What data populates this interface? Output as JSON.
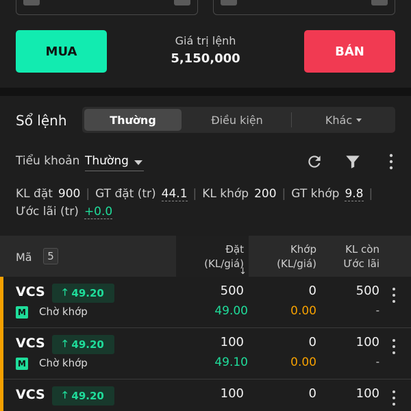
{
  "action": {
    "buy_label": "MUA",
    "sell_label": "BÁN",
    "order_value_label": "Giá trị lệnh",
    "order_value": "5,150,000"
  },
  "order_book": {
    "title": "Sổ lệnh",
    "tabs": [
      {
        "label": "Thường",
        "active": true
      },
      {
        "label": "Điều kiện",
        "active": false
      },
      {
        "label": "Khác",
        "active": false
      }
    ]
  },
  "subaccount": {
    "label": "Tiểu khoản",
    "selected": "Thường"
  },
  "stats": {
    "kl_dat_label": "KL đặt",
    "kl_dat": "900",
    "gt_dat_label": "GT đặt (tr)",
    "gt_dat": "44.1",
    "kl_khop_label": "KL khớp",
    "kl_khop": "200",
    "gt_khop_label": "GT khớp",
    "gt_khop": "9.8",
    "uoc_lai_label": "Ước lãi (tr)",
    "uoc_lai": "+0.0"
  },
  "table": {
    "col_code": "Mã",
    "count": "5",
    "col_order_1": "Đặt",
    "col_order_2": "(KL/giá)",
    "col_match_1": "Khớp",
    "col_match_2": "(KL/giá)",
    "col_rem_1": "KL còn",
    "col_rem_2": "Ước lãi",
    "rows": [
      {
        "symbol": "VCS",
        "price": "49.20",
        "market": "M",
        "status": "Chờ khớp",
        "order_qty": "500",
        "order_price": "49.00",
        "match_qty": "0",
        "match_price": "0.00",
        "remain_qty": "500",
        "est_profit": "-"
      },
      {
        "symbol": "VCS",
        "price": "49.20",
        "market": "M",
        "status": "Chờ khớp",
        "order_qty": "100",
        "order_price": "49.10",
        "match_qty": "0",
        "match_price": "0.00",
        "remain_qty": "100",
        "est_profit": "-"
      },
      {
        "symbol": "VCS",
        "price": "49.20",
        "market": "",
        "status": "",
        "order_qty": "100",
        "order_price": "",
        "match_qty": "0",
        "match_price": "",
        "remain_qty": "100",
        "est_profit": ""
      }
    ]
  },
  "colors": {
    "buy": "#12ebb0",
    "sell": "#f13a52",
    "up": "#1fdc9a",
    "pending": "#f5a000"
  }
}
